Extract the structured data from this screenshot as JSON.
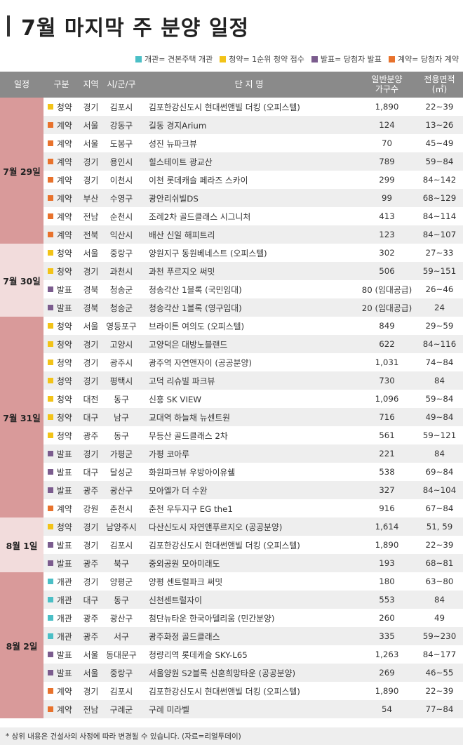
{
  "title": "7월 마지막 주 분양 일정",
  "legend": [
    {
      "text": "개관= 견본주택 개관",
      "color": "#4bbfc6"
    },
    {
      "text": "청약= 1순위 청약 접수",
      "color": "#f2c318"
    },
    {
      "text": "발표= 당첨자 발표",
      "color": "#7b5c8e"
    },
    {
      "text": "계약= 당첨자 계약",
      "color": "#e8722c"
    }
  ],
  "headers": {
    "date": "일정",
    "type": "구분",
    "region": "지역",
    "city": "시/군/구",
    "name": "단 지 명",
    "units": "일반분양\n가구수",
    "area": "전용면적\n(㎡)"
  },
  "type_colors": {
    "개관": "#4bbfc6",
    "청약": "#f2c318",
    "발표": "#7b5c8e",
    "계약": "#e8722c"
  },
  "groups": [
    {
      "date": "7월 29일",
      "rows": [
        {
          "type": "청약",
          "region": "경기",
          "city": "김포시",
          "name": "김포한강신도시 현대썬앤빌 더킹 (오피스텔)",
          "units": "1,890",
          "area": "22~39"
        },
        {
          "type": "계약",
          "region": "서울",
          "city": "강동구",
          "name": "길동 경지Arium",
          "units": "124",
          "area": "13~26"
        },
        {
          "type": "계약",
          "region": "서울",
          "city": "도봉구",
          "name": "성진 뉴파크뷰",
          "units": "70",
          "area": "45~49"
        },
        {
          "type": "계약",
          "region": "경기",
          "city": "용인시",
          "name": "힐스테이트 광교산",
          "units": "789",
          "area": "59~84"
        },
        {
          "type": "계약",
          "region": "경기",
          "city": "이천시",
          "name": "이천 롯데캐슬 페라즈 스카이",
          "units": "299",
          "area": "84~142"
        },
        {
          "type": "계약",
          "region": "부산",
          "city": "수영구",
          "name": "광안리쉬빌DS",
          "units": "99",
          "area": "68~129"
        },
        {
          "type": "계약",
          "region": "전남",
          "city": "순천시",
          "name": "조례2차 골드클래스 시그니처",
          "units": "413",
          "area": "84~114"
        },
        {
          "type": "계약",
          "region": "전북",
          "city": "익산시",
          "name": "배산 신일 해피트리",
          "units": "123",
          "area": "84~107"
        }
      ]
    },
    {
      "date": "7월 30일",
      "rows": [
        {
          "type": "청약",
          "region": "서울",
          "city": "중랑구",
          "name": "양원지구 동원베네스트 (오피스텔)",
          "units": "302",
          "area": "27~33"
        },
        {
          "type": "청약",
          "region": "경기",
          "city": "과천시",
          "name": "과천 푸르지오 써밋",
          "units": "506",
          "area": "59~151"
        },
        {
          "type": "발표",
          "region": "경북",
          "city": "청송군",
          "name": "청송각산 1블록 (국민임대)",
          "units": "80 (임대공급)",
          "area": "26~46"
        },
        {
          "type": "발표",
          "region": "경북",
          "city": "청송군",
          "name": "청송각산 1블록 (영구임대)",
          "units": "20 (임대공급)",
          "area": "24"
        }
      ]
    },
    {
      "date": "7월 31일",
      "rows": [
        {
          "type": "청약",
          "region": "서울",
          "city": "영등포구",
          "name": "브라이튼 여의도 (오피스텔)",
          "units": "849",
          "area": "29~59"
        },
        {
          "type": "청약",
          "region": "경기",
          "city": "고양시",
          "name": "고양덕은 대방노블랜드",
          "units": "622",
          "area": "84~116"
        },
        {
          "type": "청약",
          "region": "경기",
          "city": "광주시",
          "name": "광주역 자연앤자이 (공공분양)",
          "units": "1,031",
          "area": "74~84"
        },
        {
          "type": "청약",
          "region": "경기",
          "city": "평택시",
          "name": "고덕 리슈빌 파크뷰",
          "units": "730",
          "area": "84"
        },
        {
          "type": "청약",
          "region": "대전",
          "city": "동구",
          "name": "신흥 SK VIEW",
          "units": "1,096",
          "area": "59~84"
        },
        {
          "type": "청약",
          "region": "대구",
          "city": "남구",
          "name": "교대역 하늘채 뉴센트원",
          "units": "716",
          "area": "49~84"
        },
        {
          "type": "청약",
          "region": "광주",
          "city": "동구",
          "name": "무등산 골드클래스 2차",
          "units": "561",
          "area": "59~121"
        },
        {
          "type": "발표",
          "region": "경기",
          "city": "가평군",
          "name": "가평 코아루",
          "units": "221",
          "area": "84"
        },
        {
          "type": "발표",
          "region": "대구",
          "city": "달성군",
          "name": "화원파크뷰 우방아이유쉘",
          "units": "538",
          "area": "69~84"
        },
        {
          "type": "발표",
          "region": "광주",
          "city": "광산구",
          "name": "모아엘가 더 수완",
          "units": "327",
          "area": "84~104"
        },
        {
          "type": "계약",
          "region": "강원",
          "city": "춘천시",
          "name": "춘천 우두지구 EG the1",
          "units": "916",
          "area": "67~84"
        }
      ]
    },
    {
      "date": "8월 1일",
      "rows": [
        {
          "type": "청약",
          "region": "경기",
          "city": "남양주시",
          "name": "다산신도시 자연앤푸르지오 (공공분양)",
          "units": "1,614",
          "area": "51, 59"
        },
        {
          "type": "발표",
          "region": "경기",
          "city": "김포시",
          "name": "김포한강신도시 현대썬앤빌 더킹 (오피스텔)",
          "units": "1,890",
          "area": "22~39"
        },
        {
          "type": "발표",
          "region": "광주",
          "city": "북구",
          "name": "중외공원 모아미래도",
          "units": "193",
          "area": "68~81"
        }
      ]
    },
    {
      "date": "8월 2일",
      "rows": [
        {
          "type": "개관",
          "region": "경기",
          "city": "양평군",
          "name": "양평 센트럴파크 써밋",
          "units": "180",
          "area": "63~80"
        },
        {
          "type": "개관",
          "region": "대구",
          "city": "동구",
          "name": "신천센트럴자이",
          "units": "553",
          "area": "84"
        },
        {
          "type": "개관",
          "region": "광주",
          "city": "광산구",
          "name": "첨단뉴타운 한국아델리움 (민간분양)",
          "units": "260",
          "area": "49"
        },
        {
          "type": "개관",
          "region": "광주",
          "city": "서구",
          "name": "광주화정 골드클래스",
          "units": "335",
          "area": "59~230"
        },
        {
          "type": "발표",
          "region": "서울",
          "city": "동대문구",
          "name": "청량리역 롯데캐슬 SKY-L65",
          "units": "1,263",
          "area": "84~177"
        },
        {
          "type": "발표",
          "region": "서울",
          "city": "중랑구",
          "name": "서울양원 S2블록 신혼희망타운 (공공분양)",
          "units": "269",
          "area": "46~55"
        },
        {
          "type": "계약",
          "region": "경기",
          "city": "김포시",
          "name": "김포한강신도시 현대썬앤빌 더킹 (오피스텔)",
          "units": "1,890",
          "area": "22~39"
        },
        {
          "type": "계약",
          "region": "전남",
          "city": "구례군",
          "name": "구례 미라벨",
          "units": "54",
          "area": "77~84"
        }
      ]
    }
  ],
  "footnote": "* 상위 내용은 건설사의 사정에 따라 변경될 수 있습니다. (자료=리얼투데이)"
}
